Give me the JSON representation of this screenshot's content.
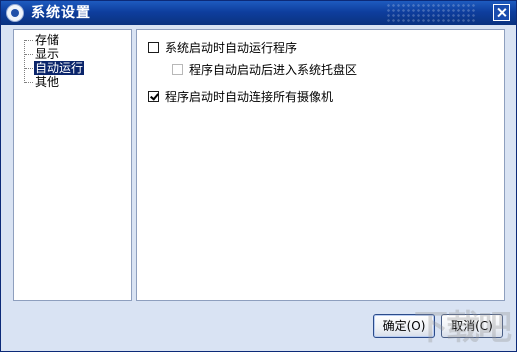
{
  "window": {
    "title": "系统设置",
    "icons": {
      "app": "app-icon",
      "close": "close-icon"
    }
  },
  "tree": {
    "items": [
      {
        "label": "存储",
        "selected": false
      },
      {
        "label": "显示",
        "selected": false
      },
      {
        "label": "自动运行",
        "selected": true
      },
      {
        "label": "其他",
        "selected": false
      }
    ]
  },
  "options": {
    "auto_run": {
      "label": "系统启动时自动运行程序",
      "checked": false
    },
    "tray": {
      "label": "程序自动启动后进入系统托盘区",
      "checked": false,
      "enabled": false
    },
    "connect_cameras": {
      "label": "程序启动时自动连接所有摄像机",
      "checked": true
    }
  },
  "buttons": {
    "ok": "确定(O)",
    "cancel": "取消(C)"
  },
  "watermark": {
    "text": "下载吧"
  },
  "colors": {
    "titlebar": "#0e3e9e",
    "dialog_bg": "#d9e3f3",
    "selection": "#0a246a"
  }
}
